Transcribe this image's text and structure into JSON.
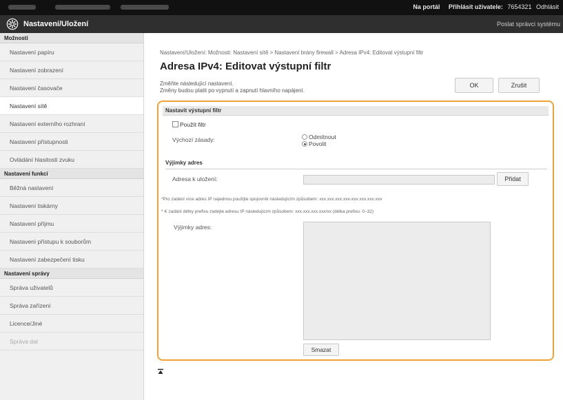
{
  "topbar": {
    "portal_link": "Na portál",
    "user_label": "Přihlásit uživatele:",
    "user_name": "7654321",
    "logout": "Odhlásit"
  },
  "header": {
    "title": "Nastavení/Uložení",
    "portal": "Poslat správci systému"
  },
  "sidebar": {
    "sections": [
      {
        "title": "Možnosti",
        "items": [
          {
            "label": "Nastavení papíru"
          },
          {
            "label": "Nastavení zobrazení"
          },
          {
            "label": "Nastavení časovače"
          },
          {
            "label": "Nastavení sítě"
          },
          {
            "label": "Nastavení externího rozhraní"
          },
          {
            "label": "Nastavení přístupnosti"
          },
          {
            "label": "Ovládání hlasitosti zvuku"
          }
        ]
      },
      {
        "title": "Nastavení funkcí",
        "items": [
          {
            "label": "Běžná nastavení"
          },
          {
            "label": "Nastavení tiskárny"
          },
          {
            "label": "Nastavení příjmu"
          },
          {
            "label": "Nastavení přístupu k souborům"
          },
          {
            "label": "Nastavení zabezpečení tisku"
          }
        ]
      },
      {
        "title": "Nastavení správy",
        "items": [
          {
            "label": "Správa uživatelů"
          },
          {
            "label": "Správa zařízení"
          },
          {
            "label": "Licence/Jiné"
          },
          {
            "label": "Správa dat"
          }
        ]
      }
    ]
  },
  "main": {
    "breadcrumb": "Nastavení/Uložení: Možnosti: Nastavení sítě > Nastavení brány firewall > Adresa IPv4: Editovat výstupní filtr",
    "title": "Adresa IPv4: Editovat výstupní filtr",
    "hint_line1": "Změňte následující nastavení.",
    "hint_line2": "Změny budou platit po vypnutí a zapnutí hlavního napájení.",
    "ok_label": "OK",
    "cancel_label": "Zrušit",
    "section_title": "Nastavit výstupní filtr",
    "use_filter_label": "Použít filtr",
    "default_policy_label": "Výchozí zásady:",
    "policy_reject": "Odmítnout",
    "policy_allow": "Povolit",
    "exceptions_title": "Výjimky adres",
    "address_label": "Adresa k uložení:",
    "address_value": "",
    "add_label": "Přidat",
    "note1": "*Pro zadání více adres IP najednou použijte spojovník následujícím způsobem: xxx.xxx.xxx.xxx-xxx.xxx.xxx.xxx",
    "note2": "* K zadání délky prefixu zadejte adresu IP následujícím způsobem: xxx.xxx.xxx.xxx/xx (délka prefixu: 0–32)",
    "exceptions_label": "Výjimky adres:",
    "delete_label": "Smazat"
  },
  "colors": {
    "highlight": "#f0a232",
    "topbar": "#111111",
    "header": "#2f2f2f"
  }
}
